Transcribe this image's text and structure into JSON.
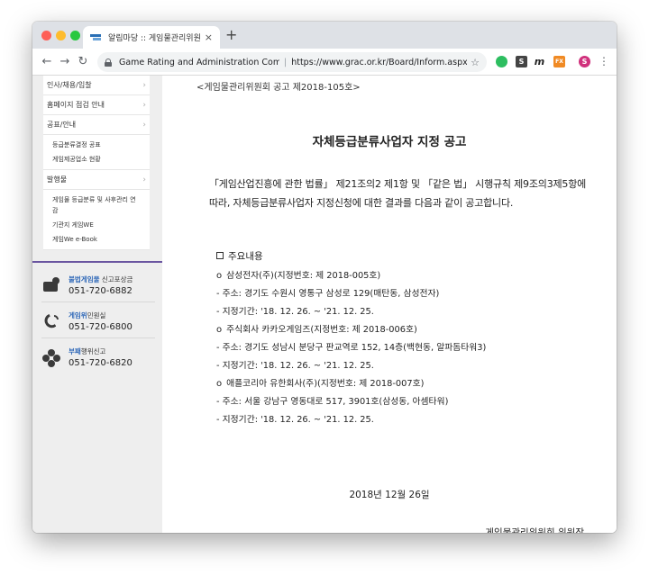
{
  "browser": {
    "tab_title": "알림마당 :: 게임물관리위원회",
    "tab_close": "×",
    "new_tab": "+",
    "site_name": "Game Rating and Administration Committee",
    "url": "https://www.grac.or.kr/Board/Inform.aspx?sea...",
    "profile_initial": "S",
    "extensions": [
      "S",
      "m",
      "FX"
    ]
  },
  "sidebar": {
    "menu": [
      {
        "label": "인사/채용/입찰"
      },
      {
        "label": "홈페이지 점검 안내"
      },
      {
        "label": "공표/안내"
      }
    ],
    "submenu_1": [
      "등급분류결정 공표",
      "게임제공업소 현황"
    ],
    "menu_4": {
      "label": "발행물"
    },
    "submenu_2": [
      "게임물 등급분류 및 사후관리 연감",
      "기관지 게임WE",
      "게임We e-Book"
    ],
    "contacts": [
      {
        "title_highlight": "불법게임물",
        "title_rest": " 신고포상금",
        "phone": "051-720-6882"
      },
      {
        "title_highlight": "게임위",
        "title_rest": "민원실",
        "phone": "051-720-6800"
      },
      {
        "title_highlight": "부패",
        "title_rest": "행위신고",
        "phone": "051-720-6820"
      }
    ]
  },
  "notice": {
    "number": "<게임물관리위원회 공고 제2018-105호>",
    "title": "자체등급분류사업자 지정 공고",
    "intro": "「게임산업진흥에 관한 법률」 제21조의2 제1항 및 「같은 법」 시행규칙 제9조의3제5항에 따라, 자체등급분류사업자 지정신청에 대한 결과를 다음과 같이 공고합니다.",
    "section_head": "주요내용",
    "companies": [
      {
        "name": "삼성전자(주)(지정번호: 제 2018-005호)",
        "address": " - 주소: 경기도 수원시 영통구 삼성로 129(매탄동, 삼성전자)",
        "period": " - 지정기간: '18. 12. 26. ~ '21. 12. 25."
      },
      {
        "name": "주식회사 카카오게임즈(지정번호: 제 2018-006호)",
        "address": " - 주소: 경기도 성남시 분당구 판교역로 152, 14층(백현동, 알파돔타워3)",
        "period": " - 지정기간: '18. 12. 26. ~ '21. 12. 25."
      },
      {
        "name": "애플코리아 유한회사(주)(지정번호: 제 2018-007호)",
        "address": " - 주소: 서울 강남구 영동대로 517, 3901호(삼성동, 아셈타워)",
        "period": " - 지정기간: '18. 12. 26. ~ '21. 12. 25."
      }
    ],
    "date": "2018년 12월 26일",
    "signature": "게임물관리위원회 위원장"
  }
}
